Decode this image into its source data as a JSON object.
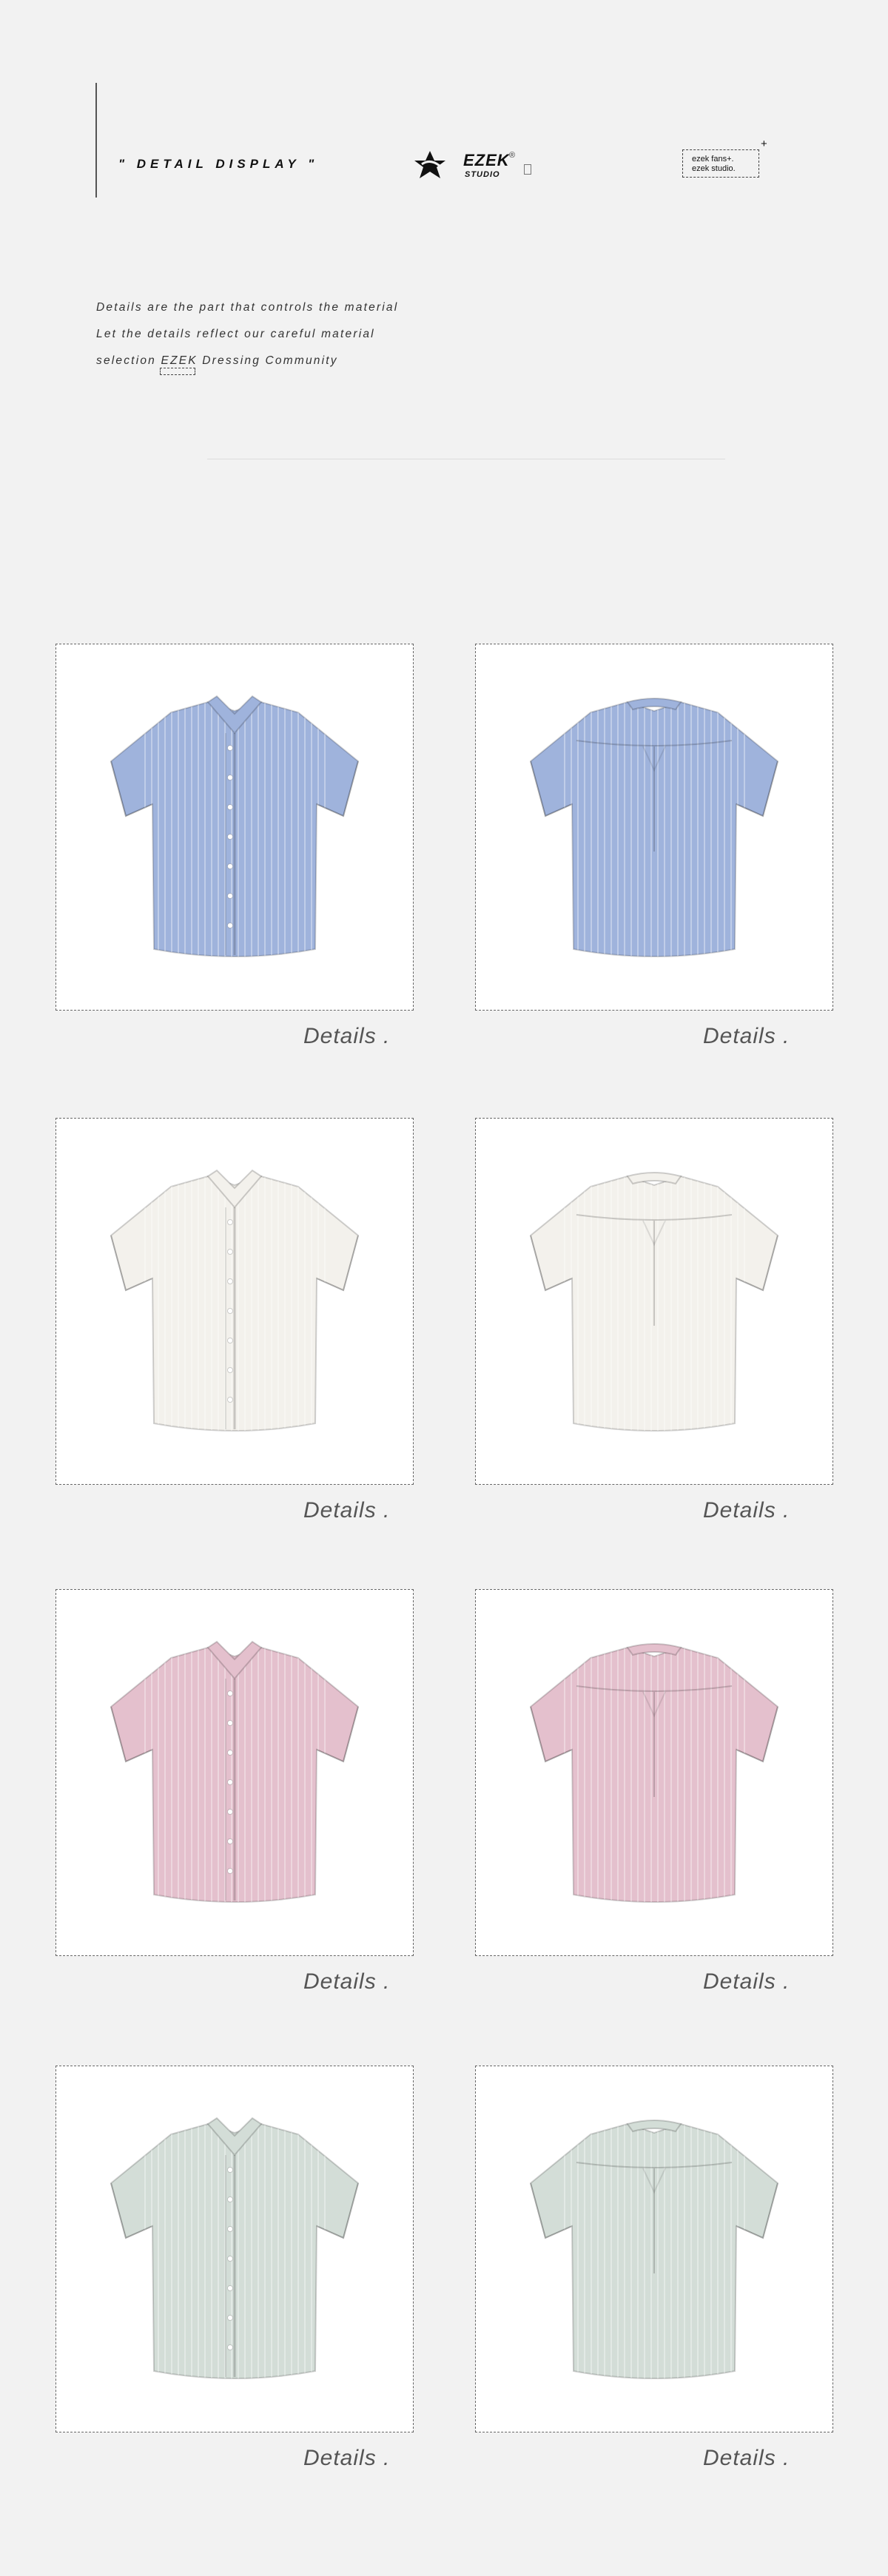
{
  "header": {
    "title": "\" DETAIL DISPLAY \"",
    "brand": "EZEK",
    "brand_reg": "®",
    "brand_sub": "STUDIO",
    "fans_line1": "ezek fans+.",
    "fans_line2": "ezek studio.",
    "plus": "+"
  },
  "description": {
    "line1": "Details are the part that controls the material",
    "line2": "Let the details reflect our careful material",
    "line3": "selection EZEK Dressing Community"
  },
  "gallery": {
    "caption": "Details .",
    "colors": {
      "blue": "#9fb3dc",
      "white": "#f3f1ec",
      "pink": "#e4c0cd",
      "mint": "#d3ddd7"
    },
    "items": [
      {
        "color": "blue",
        "view": "front",
        "caption": "Details ."
      },
      {
        "color": "blue",
        "view": "back",
        "caption": "Details ."
      },
      {
        "color": "white",
        "view": "front",
        "caption": "Details ."
      },
      {
        "color": "white",
        "view": "back",
        "caption": "Details ."
      },
      {
        "color": "pink",
        "view": "front",
        "caption": "Details ."
      },
      {
        "color": "pink",
        "view": "back",
        "caption": "Details ."
      },
      {
        "color": "mint",
        "view": "front",
        "caption": "Details ."
      },
      {
        "color": "mint",
        "view": "back",
        "caption": "Details ."
      }
    ]
  }
}
